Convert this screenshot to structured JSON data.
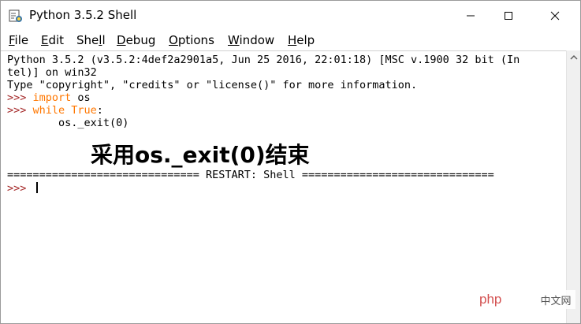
{
  "window": {
    "title": "Python 3.5.2 Shell"
  },
  "menu": [
    {
      "pre": "",
      "u": "F",
      "post": "ile"
    },
    {
      "pre": "",
      "u": "E",
      "post": "dit"
    },
    {
      "pre": "She",
      "u": "l",
      "post": "l"
    },
    {
      "pre": "",
      "u": "D",
      "post": "ebug"
    },
    {
      "pre": "",
      "u": "O",
      "post": "ptions"
    },
    {
      "pre": "",
      "u": "W",
      "post": "indow"
    },
    {
      "pre": "",
      "u": "H",
      "post": "elp"
    }
  ],
  "shell": {
    "banner_line1": "Python 3.5.2 (v3.5.2:4def2a2901a5, Jun 25 2016, 22:01:18) [MSC v.1900 32 bit (In",
    "banner_line2": "tel)] on win32",
    "banner_line3": "Type \"copyright\", \"credits\" or \"license()\" for more information.",
    "prompt": ">>> ",
    "cmd1_kw": "import",
    "cmd1_rest": " os",
    "cmd2_kw": "while True",
    "cmd2_rest": ":",
    "cmd3": "        os._exit(0)",
    "restart_line": "============================== RESTART: Shell ==============================",
    "final_prompt": ">>> "
  },
  "annotation": "采用os._exit(0)结束",
  "watermark": {
    "brand": "php",
    "site": "中文网"
  },
  "colors": {
    "prompt": "#a52a2a",
    "keyword": "#ff7700"
  },
  "icons": {
    "app": "python-idle-icon",
    "minimize": "minimize-icon",
    "maximize": "maximize-icon",
    "close": "close-icon",
    "scroll_up": "arrow-up-icon"
  }
}
